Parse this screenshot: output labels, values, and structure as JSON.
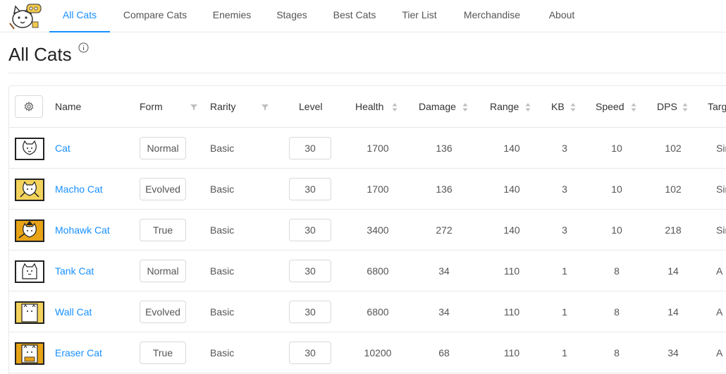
{
  "nav": {
    "tabs": [
      {
        "label": "All Cats",
        "active": true
      },
      {
        "label": "Compare Cats"
      },
      {
        "label": "Enemies"
      },
      {
        "label": "Stages"
      },
      {
        "label": "Best Cats"
      },
      {
        "label": "Tier List"
      },
      {
        "label": "Merchandise"
      },
      {
        "label": "About"
      }
    ]
  },
  "page": {
    "title": "All Cats"
  },
  "table": {
    "headers": {
      "name": "Name",
      "form": "Form",
      "rarity": "Rarity",
      "level": "Level",
      "health": "Health",
      "damage": "Damage",
      "range": "Range",
      "kb": "KB",
      "speed": "Speed",
      "dps": "DPS",
      "target": "Targ"
    },
    "rows": [
      {
        "name": "Cat",
        "form": "Normal",
        "rarity": "Basic",
        "level": "30",
        "health": "1700",
        "damage": "136",
        "range": "140",
        "kb": "3",
        "speed": "10",
        "dps": "102",
        "target": "Sir"
      },
      {
        "name": "Macho Cat",
        "form": "Evolved",
        "rarity": "Basic",
        "level": "30",
        "health": "1700",
        "damage": "136",
        "range": "140",
        "kb": "3",
        "speed": "10",
        "dps": "102",
        "target": "Sir"
      },
      {
        "name": "Mohawk Cat",
        "form": "True",
        "rarity": "Basic",
        "level": "30",
        "health": "3400",
        "damage": "272",
        "range": "140",
        "kb": "3",
        "speed": "10",
        "dps": "218",
        "target": "Sir"
      },
      {
        "name": "Tank Cat",
        "form": "Normal",
        "rarity": "Basic",
        "level": "30",
        "health": "6800",
        "damage": "34",
        "range": "110",
        "kb": "1",
        "speed": "8",
        "dps": "14",
        "target": "A"
      },
      {
        "name": "Wall Cat",
        "form": "Evolved",
        "rarity": "Basic",
        "level": "30",
        "health": "6800",
        "damage": "34",
        "range": "110",
        "kb": "1",
        "speed": "8",
        "dps": "14",
        "target": "A"
      },
      {
        "name": "Eraser Cat",
        "form": "True",
        "rarity": "Basic",
        "level": "30",
        "health": "10200",
        "damage": "68",
        "range": "110",
        "kb": "1",
        "speed": "8",
        "dps": "34",
        "target": "A"
      }
    ]
  },
  "icons": {
    "logo": "cat-mascot-logo",
    "info": "info-icon",
    "settings": "gear-icon",
    "sort": "sort-caret-icon",
    "filter": "filter-funnel-icon"
  },
  "colors": {
    "accent": "#1890ff",
    "border": "#e8e8e8",
    "text": "#555555",
    "thumb_normal_bg": "#ffffff",
    "thumb_evolved_bg": "#f3d35b",
    "thumb_true_bg": "#e8a317"
  }
}
